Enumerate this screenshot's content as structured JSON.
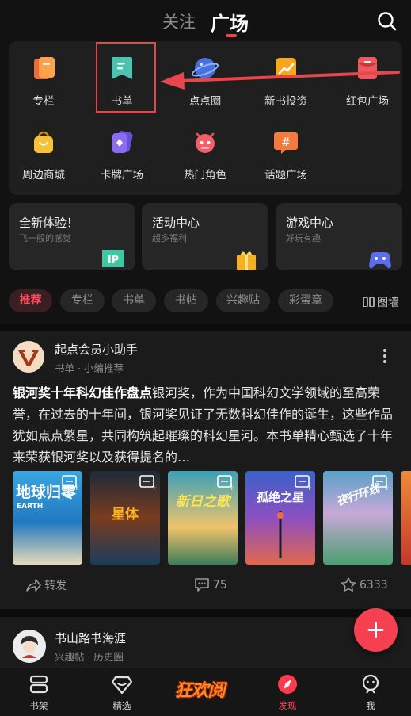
{
  "header": {
    "tab_follow": "关注",
    "tab_square": "广场",
    "accent": "#ff3b4d"
  },
  "grid": {
    "items": [
      {
        "label": "专栏",
        "icon": "column-icon"
      },
      {
        "label": "书单",
        "icon": "booklist-icon"
      },
      {
        "label": "点点圈",
        "icon": "planet-icon"
      },
      {
        "label": "新书投资",
        "icon": "new-book-invest-icon"
      },
      {
        "label": "红包广场",
        "icon": "red-packet-icon"
      },
      {
        "label": "周边商城",
        "icon": "shopping-bag-icon"
      },
      {
        "label": "卡牌广场",
        "icon": "card-icon"
      },
      {
        "label": "热门角色",
        "icon": "character-icon"
      },
      {
        "label": "话题广场",
        "icon": "topic-icon"
      }
    ]
  },
  "features": [
    {
      "title": "全新体验！",
      "sub": "飞一般的感觉",
      "icon": "ip-icon"
    },
    {
      "title": "活动中心",
      "sub": "超多福利",
      "icon": "gift-icon"
    },
    {
      "title": "游戏中心",
      "sub": "好玩有趣",
      "icon": "gamepad-icon"
    }
  ],
  "chips": [
    "推荐",
    "专栏",
    "书单",
    "书帖",
    "兴趣贴",
    "彩蛋章"
  ],
  "grid_toggle": "图墙",
  "post": {
    "author": "起点会员小助手",
    "meta": "书单 · 小编推荐",
    "title": "银河奖十年科幻佳作盘点",
    "body": "银河奖，作为中国科幻文学领域的至高荣誉，在过去的十年间，银河奖见证了无数科幻佳作的诞生，这些作品犹如点点繁星，共同构筑起璀璨的科幻星河。本书单精心甄选了十年来荣获银河奖以及获得提名的…",
    "books": [
      {
        "title": "地球归零",
        "sub": "EARTH"
      },
      {
        "title": "星体",
        "sub": ""
      },
      {
        "title": "新日之歌",
        "sub": ""
      },
      {
        "title": "孤绝之星",
        "sub": ""
      },
      {
        "title": "夜行环线",
        "sub": ""
      }
    ],
    "actions": {
      "share": "转发",
      "comments": "75",
      "likes": "6333"
    }
  },
  "post2": {
    "author": "书山路书海涯",
    "meta": "兴趣帖 · 历史圈"
  },
  "bottom_nav": {
    "items": [
      {
        "label": "书架",
        "icon": "bookshelf-icon"
      },
      {
        "label": "精选",
        "icon": "diamond-icon"
      },
      {
        "label": "发现",
        "icon": "compass-icon"
      },
      {
        "label": "我",
        "icon": "profile-icon"
      }
    ],
    "promo": "狂欢阅"
  }
}
